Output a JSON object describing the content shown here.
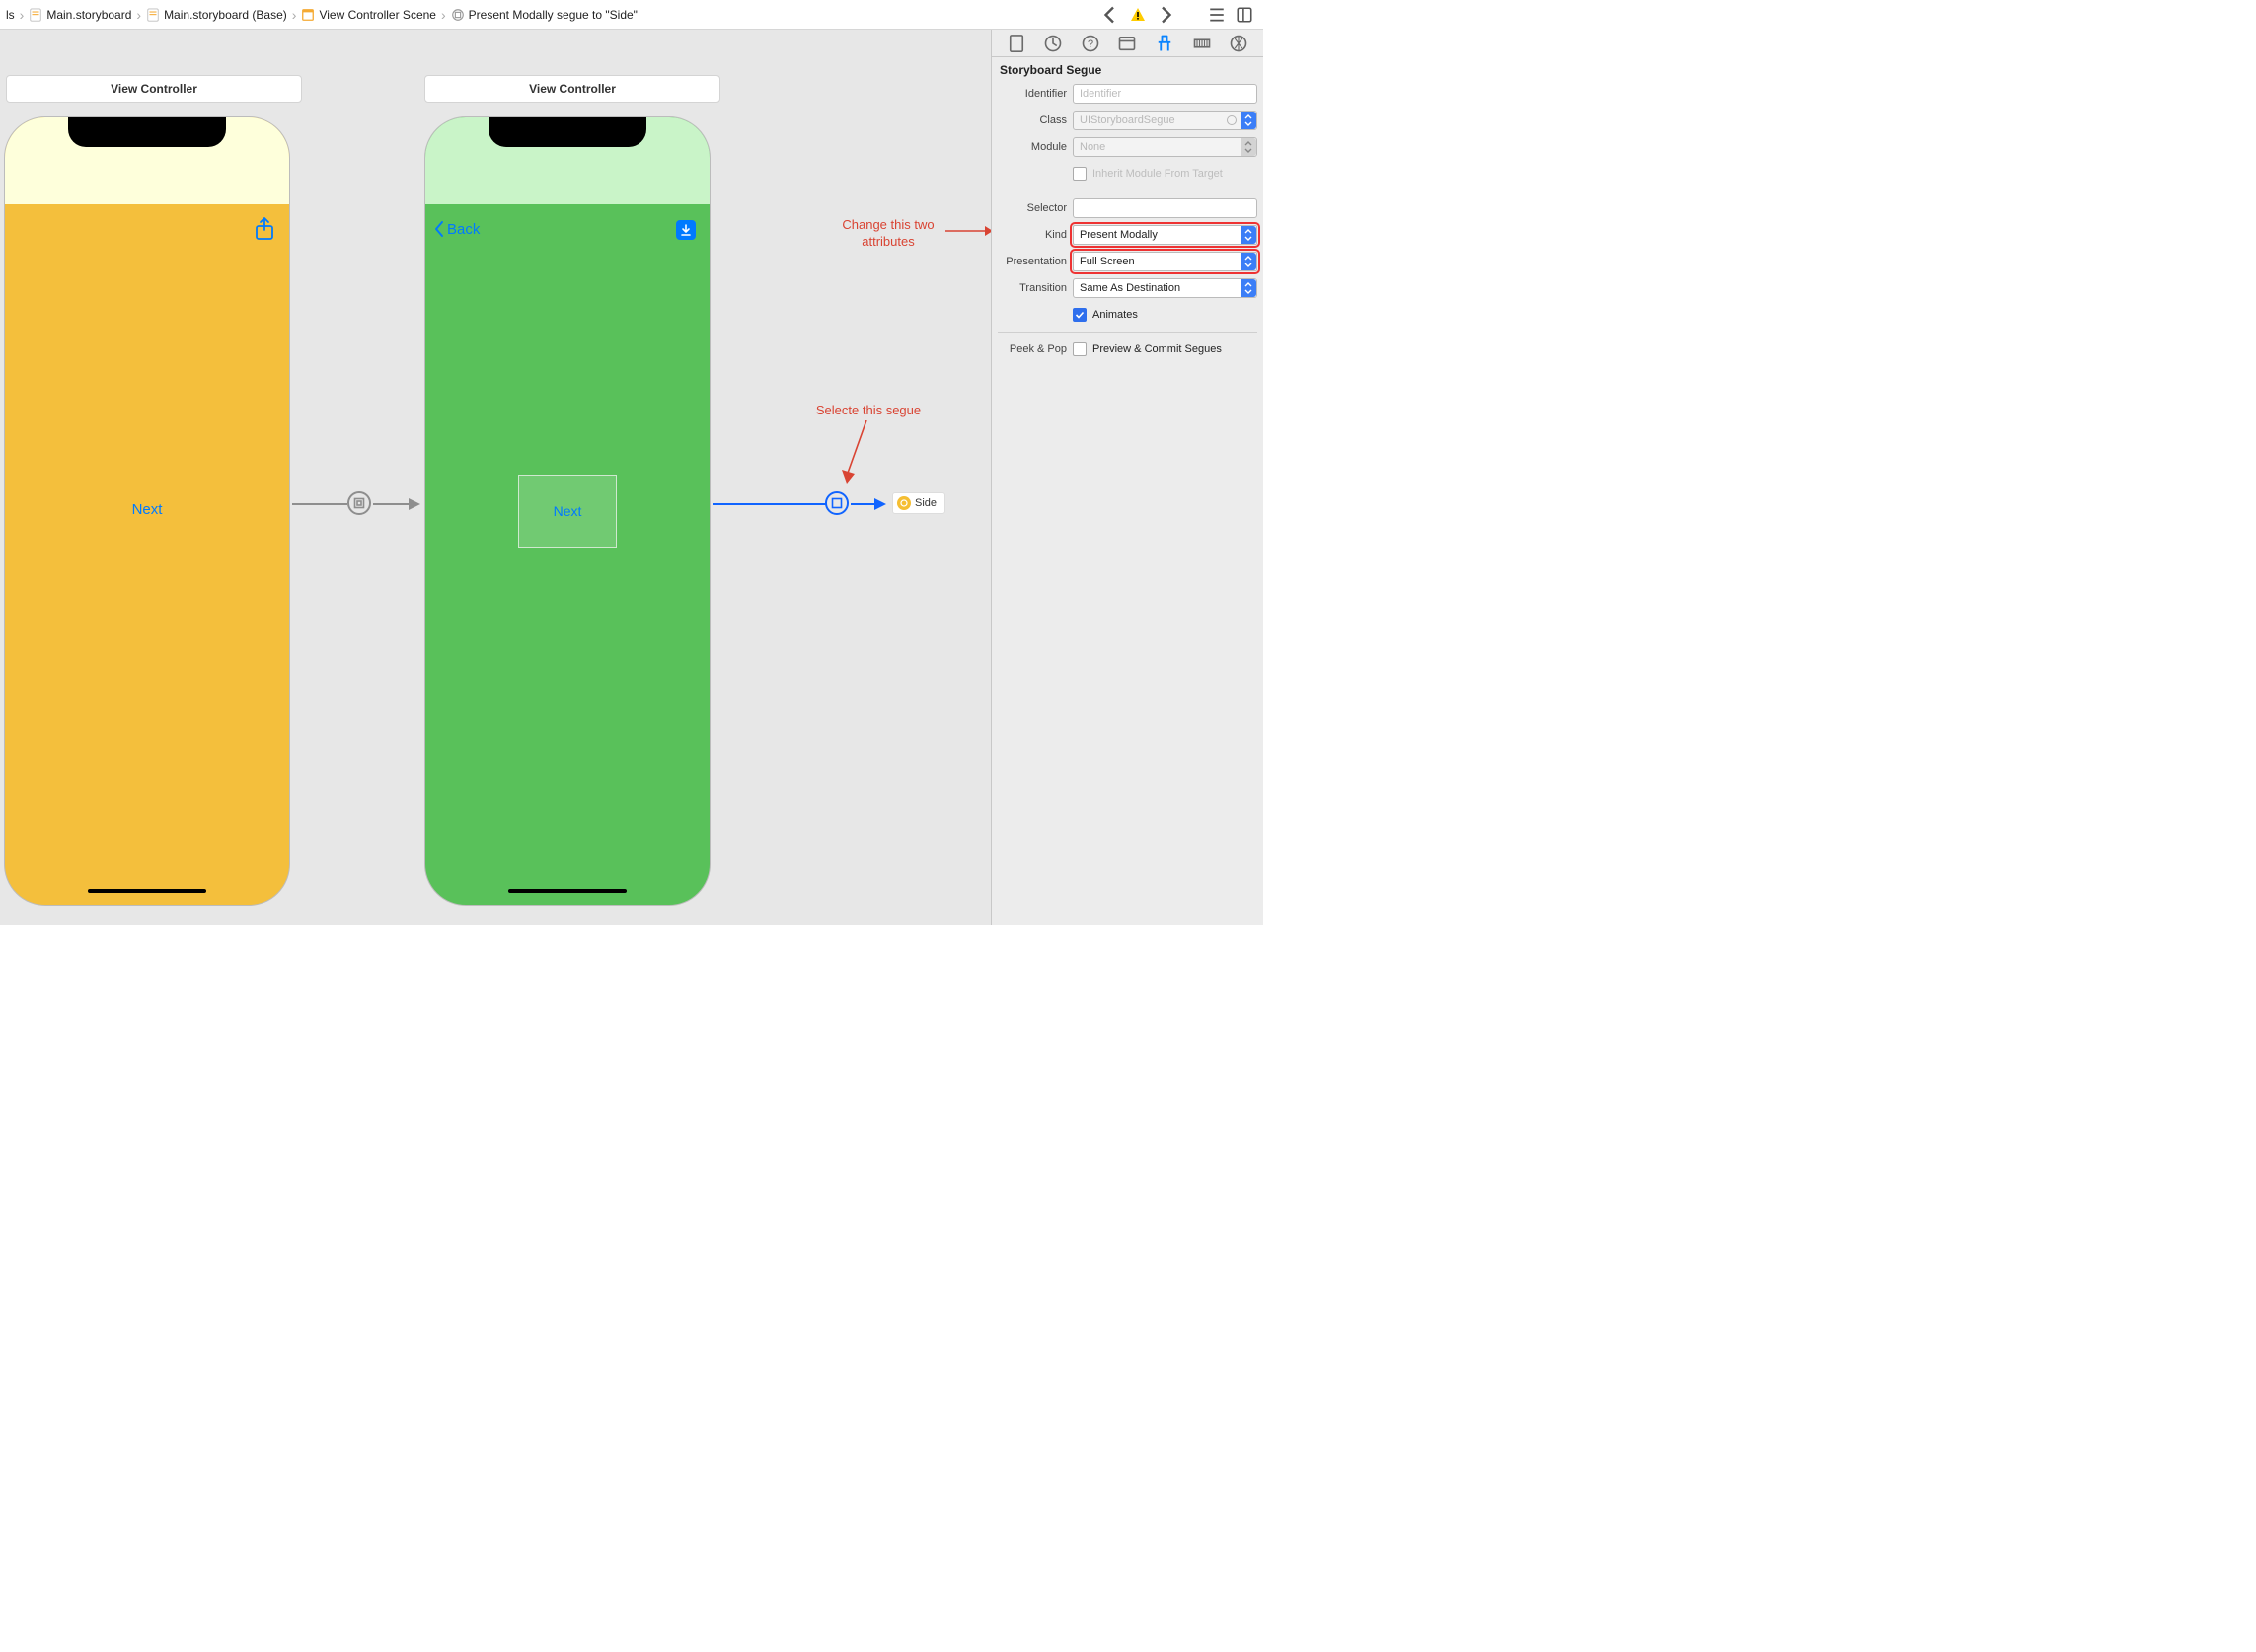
{
  "breadcrumb": {
    "b0": "ls",
    "b1": "Main.storyboard",
    "b2": "Main.storyboard (Base)",
    "b3": "View Controller Scene",
    "b4": "Present Modally segue to \"Side\""
  },
  "scenes": {
    "s1": {
      "title": "View Controller",
      "button": "Next"
    },
    "s2": {
      "title": "View Controller",
      "back": "Back",
      "button": "Next"
    },
    "side_chip": "Side"
  },
  "annotations": {
    "a1_l1": "Change this two",
    "a1_l2": "attributes",
    "a2": "Selecte this segue"
  },
  "inspector": {
    "section_title": "Storyboard Segue",
    "labels": {
      "identifier": "Identifier",
      "class": "Class",
      "module": "Module",
      "inherit": "Inherit Module From Target",
      "selector": "Selector",
      "kind": "Kind",
      "presentation": "Presentation",
      "transition": "Transition",
      "animates": "Animates",
      "peek": "Peek & Pop",
      "peek_text": "Preview & Commit Segues"
    },
    "values": {
      "class_placeholder": "UIStoryboardSegue",
      "module_placeholder": "None",
      "identifier_placeholder": "Identifier",
      "kind": "Present Modally",
      "presentation": "Full Screen",
      "transition": "Same As Destination"
    }
  }
}
